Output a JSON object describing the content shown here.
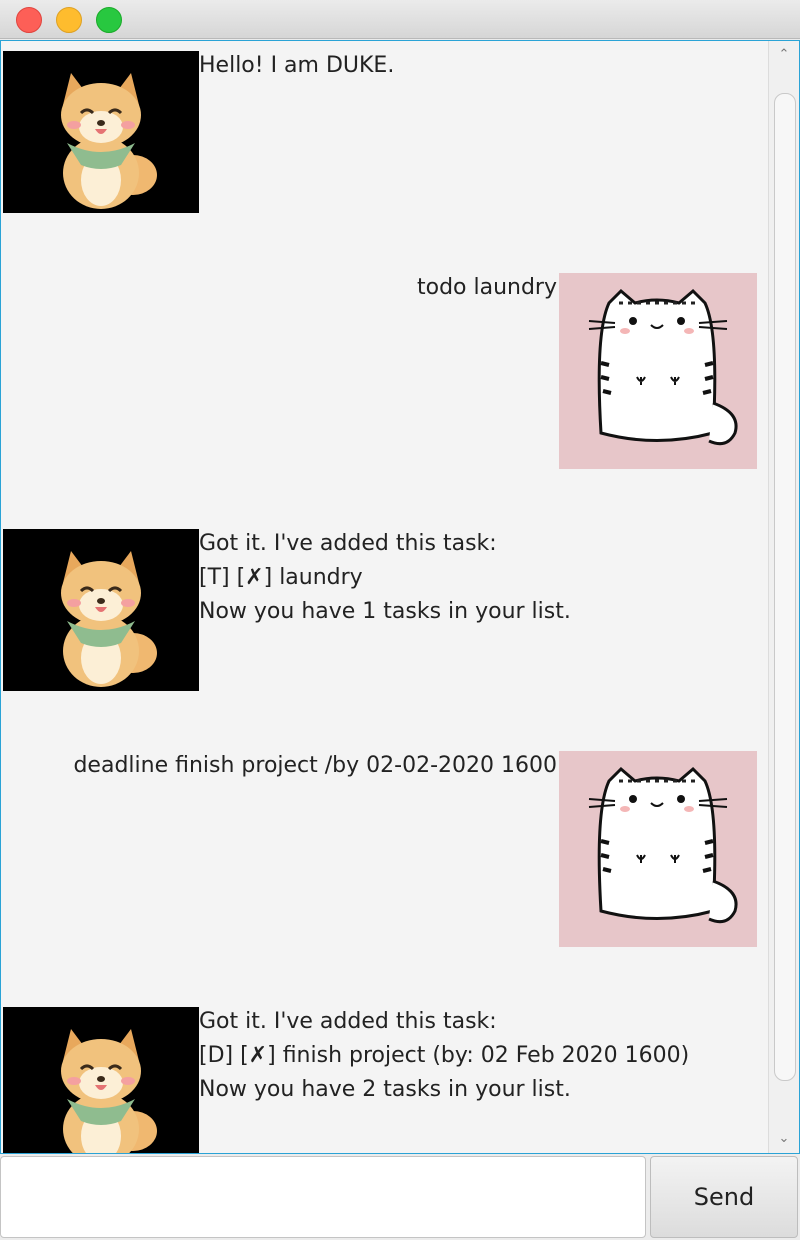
{
  "window": {
    "controls": [
      "close",
      "minimize",
      "maximize"
    ]
  },
  "messages": [
    {
      "sender": "duke",
      "avatar": "shiba-dog-icon",
      "lines": [
        "Hello! I am DUKE."
      ]
    },
    {
      "sender": "user",
      "avatar": "white-cat-icon",
      "lines": [
        "todo laundry"
      ]
    },
    {
      "sender": "duke",
      "avatar": "shiba-dog-icon",
      "lines": [
        "Got it. I've added this task:",
        "[T] [✗] laundry",
        "Now you have 1 tasks in your list."
      ]
    },
    {
      "sender": "user",
      "avatar": "white-cat-icon",
      "lines": [
        "deadline finish project /by 02-02-2020 1600"
      ]
    },
    {
      "sender": "duke",
      "avatar": "shiba-dog-icon",
      "lines": [
        "Got it. I've added this task:",
        "[D] [✗] finish project (by: 02 Feb 2020 1600)",
        "Now you have 2 tasks in your list."
      ]
    }
  ],
  "input": {
    "value": "",
    "placeholder": ""
  },
  "send_button": {
    "label": "Send"
  },
  "colors": {
    "accent": "#2aa3d6",
    "user_avatar_bg": "#e7c6c9",
    "duke_avatar_bg": "#000000"
  }
}
